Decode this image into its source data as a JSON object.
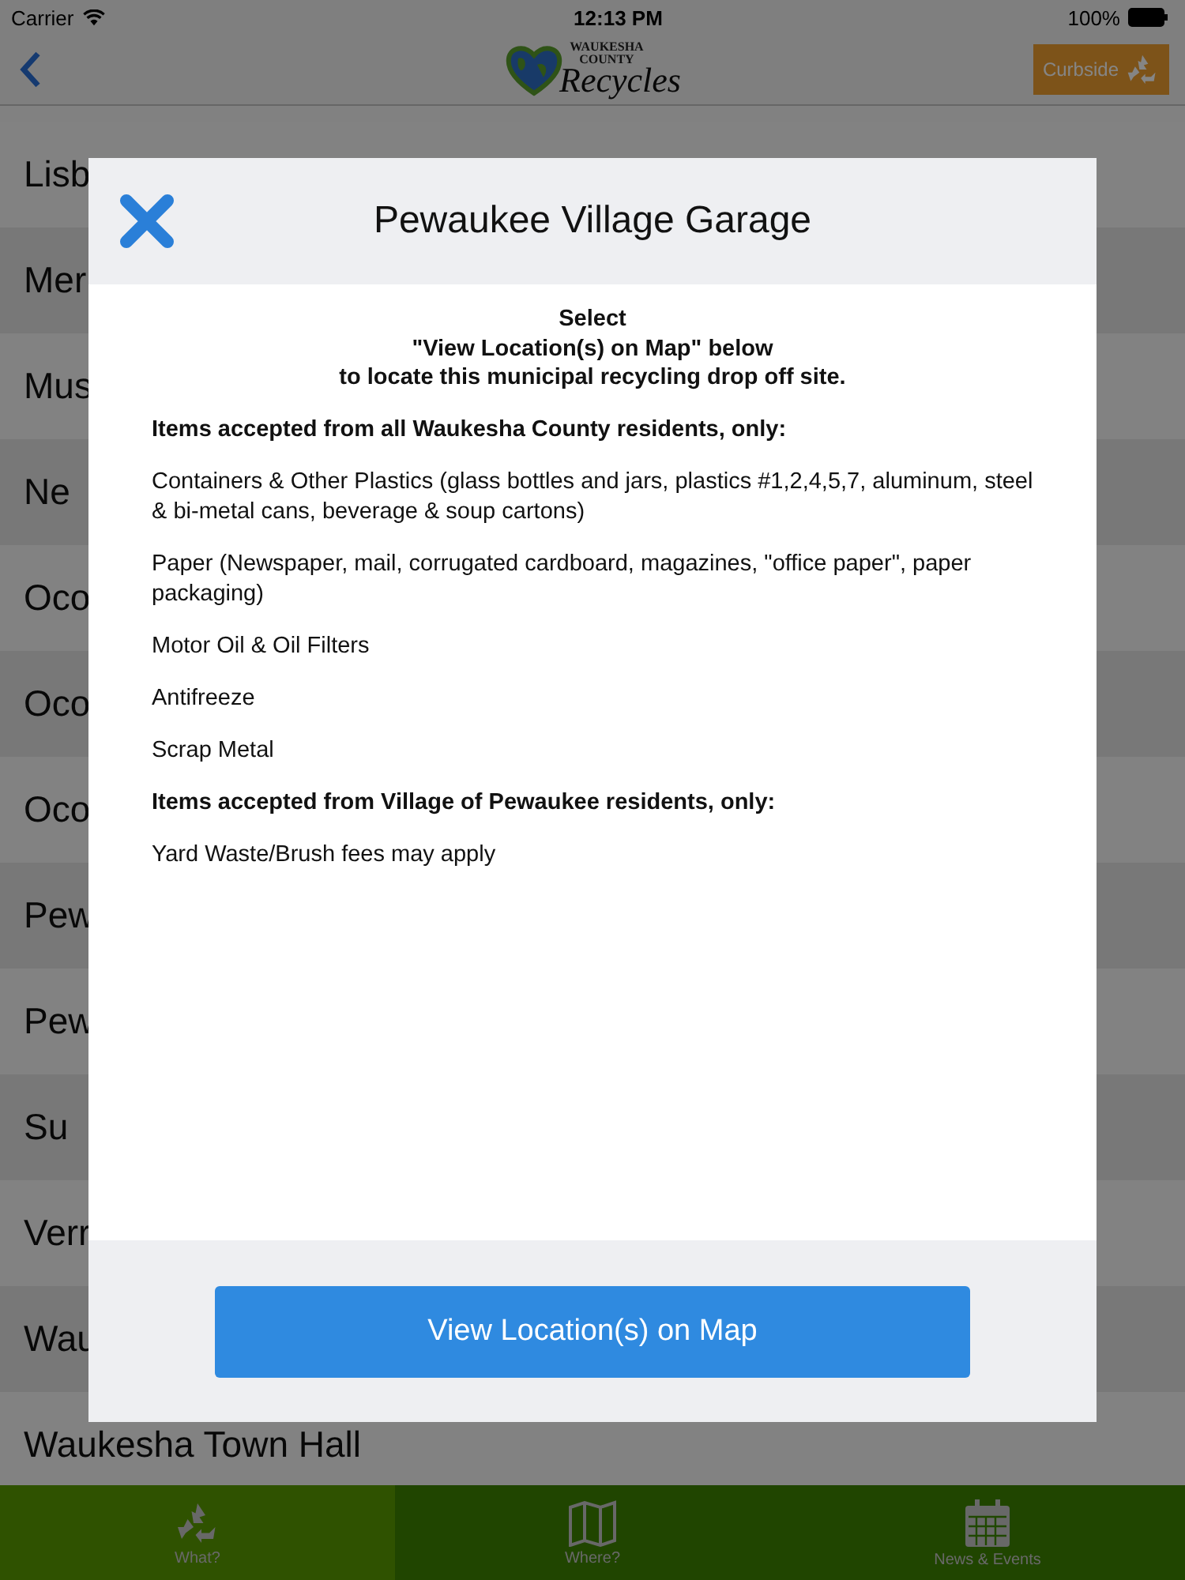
{
  "status_bar": {
    "carrier": "Carrier",
    "time": "12:13 PM",
    "battery": "100%"
  },
  "nav_bar": {
    "logo": {
      "line_1": "WAUKESHA",
      "line_2": "COUNTY",
      "line_3": "Recycles"
    },
    "curbside_button": "Curbside"
  },
  "list": {
    "rows": [
      {
        "label": "Lisb"
      },
      {
        "label": "Mer"
      },
      {
        "label": "Mus"
      },
      {
        "label": "Ne"
      },
      {
        "label": "Oco"
      },
      {
        "label": "Oco"
      },
      {
        "label": "Oco"
      },
      {
        "label": "Pew"
      },
      {
        "label": "Pew"
      },
      {
        "label": "Su"
      },
      {
        "label": "Verr"
      },
      {
        "label": "Wau"
      },
      {
        "label": "Waukesha Town Hall"
      }
    ]
  },
  "modal": {
    "title": "Pewaukee Village Garage",
    "intro": [
      "Select",
      "\"View Location(s) on Map\" below",
      "to locate this municipal recycling drop off site."
    ],
    "lines": [
      {
        "kind": "heading",
        "text": "Items accepted from all Waukesha County residents, only:"
      },
      {
        "kind": "item",
        "text": "Containers & Other Plastics (glass bottles and jars, plastics #1,2,4,5,7, aluminum, steel & bi-metal cans, beverage & soup cartons)"
      },
      {
        "kind": "item",
        "text": "Paper (Newspaper, mail, corrugated cardboard, magazines, \"office paper\", paper packaging)"
      },
      {
        "kind": "item",
        "text": "Motor Oil & Oil Filters"
      },
      {
        "kind": "item",
        "text": "Antifreeze"
      },
      {
        "kind": "item",
        "text": "Scrap Metal"
      },
      {
        "kind": "heading",
        "text": "Items accepted from Village of Pewaukee residents, only:"
      },
      {
        "kind": "item",
        "text": "Yard Waste/Brush fees may apply"
      }
    ],
    "map_button": "View Location(s) on Map"
  },
  "tab_bar": [
    {
      "label": "What?",
      "kind": "recycle",
      "selected": true
    },
    {
      "label": "Where?",
      "kind": "map",
      "selected": false
    },
    {
      "label": "News & Events",
      "kind": "calendar",
      "selected": false
    }
  ]
}
